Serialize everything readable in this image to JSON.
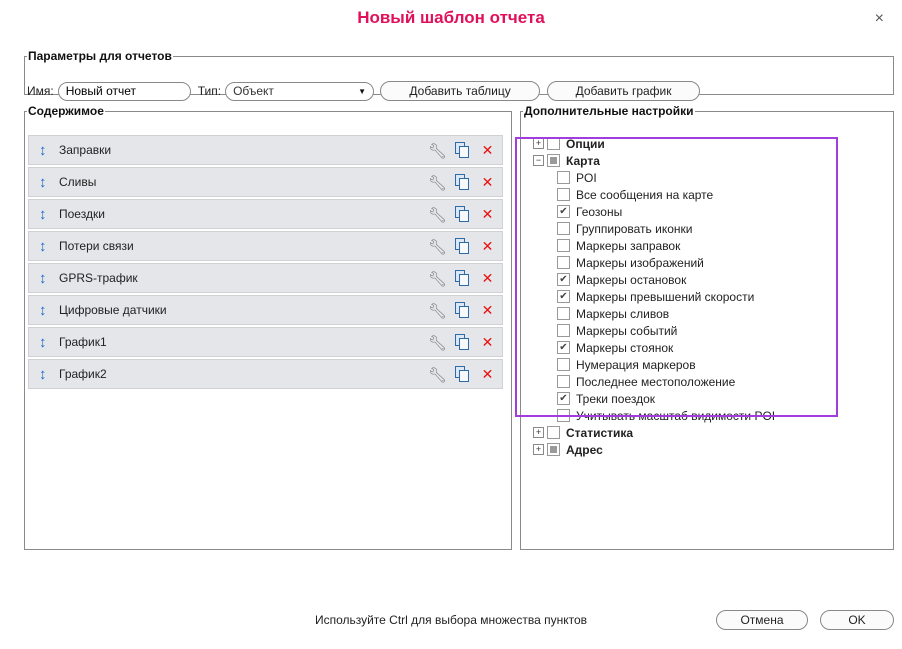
{
  "dialog": {
    "title": "Новый шаблон отчета",
    "close": "×"
  },
  "params": {
    "legend": "Параметры для отчетов",
    "name_label": "Имя:",
    "name_value": "Новый отчет",
    "type_label": "Тип:",
    "type_value": "Объект",
    "type_arrow": "▼",
    "add_table": "Добавить таблицу",
    "add_chart": "Добавить график"
  },
  "content": {
    "legend": "Содержимое",
    "rows": [
      "Заправки",
      "Сливы",
      "Поездки",
      "Потери связи",
      "GPRS-трафик",
      "Цифровые датчики",
      "График1",
      "График2"
    ],
    "icons": {
      "move": "arrow-updown-icon",
      "settings": "wrench-icon",
      "copy": "copy-icon",
      "delete": "delete-icon"
    }
  },
  "extra": {
    "legend": "Дополнительные настройки",
    "options": {
      "expander": "+",
      "label": "Опции",
      "checked": false
    },
    "map": {
      "expander": "−",
      "label": "Карта",
      "state": "partial",
      "items": [
        {
          "label": "POI",
          "checked": false
        },
        {
          "label": "Все сообщения на карте",
          "checked": false
        },
        {
          "label": "Геозоны",
          "checked": true
        },
        {
          "label": "Группировать иконки",
          "checked": false
        },
        {
          "label": "Маркеры заправок",
          "checked": false
        },
        {
          "label": "Маркеры изображений",
          "checked": false
        },
        {
          "label": "Маркеры остановок",
          "checked": true
        },
        {
          "label": "Маркеры превышений скорости",
          "checked": true
        },
        {
          "label": "Маркеры сливов",
          "checked": false
        },
        {
          "label": "Маркеры событий",
          "checked": false
        },
        {
          "label": "Маркеры стоянок",
          "checked": true
        },
        {
          "label": "Нумерация маркеров",
          "checked": false
        },
        {
          "label": "Последнее местоположение",
          "checked": false
        },
        {
          "label": "Треки поездок",
          "checked": true
        },
        {
          "label": "Учитывать масштаб видимости POI",
          "checked": false
        }
      ]
    },
    "stats": {
      "expander": "+",
      "label": "Статистика",
      "checked": false
    },
    "address": {
      "expander": "+",
      "label": "Адрес",
      "state": "partial"
    }
  },
  "footer": {
    "hint": "Используйте Ctrl для выбора множества пунктов",
    "cancel": "Отмена",
    "ok": "OK"
  },
  "colors": {
    "title": "#e0105a",
    "highlight": "#a23cdc",
    "delete": "#ee1111",
    "arrow": "#1b6fcb"
  }
}
